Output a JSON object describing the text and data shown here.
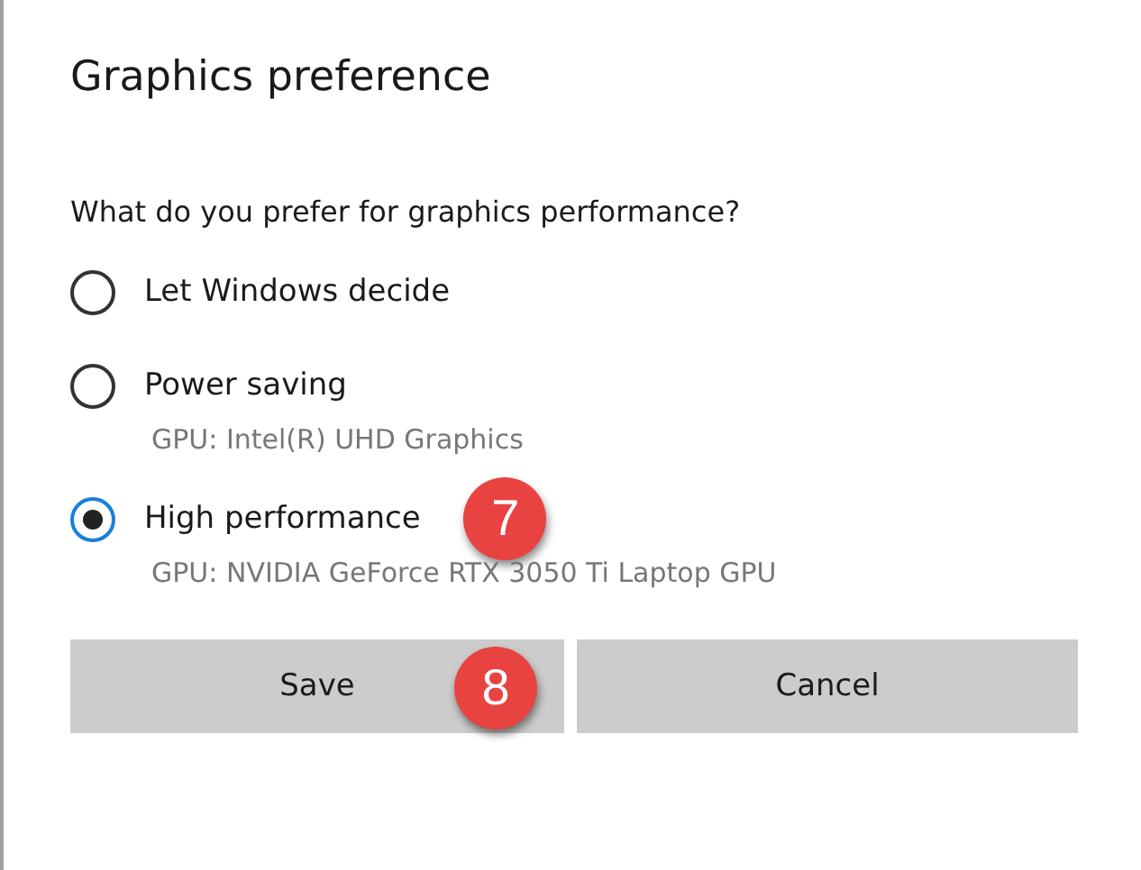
{
  "dialog": {
    "title": "Graphics preference",
    "question": "What do you prefer for graphics performance?",
    "options": [
      {
        "label": "Let Windows decide",
        "selected": false
      },
      {
        "label": "Power saving",
        "detail": "GPU: Intel(R) UHD Graphics",
        "selected": false
      },
      {
        "label": "High performance",
        "detail": "GPU: NVIDIA GeForce RTX 3050 Ti Laptop GPU",
        "selected": true,
        "callout": "7"
      }
    ],
    "buttons": [
      {
        "label": "Save",
        "callout": "8"
      },
      {
        "label": "Cancel"
      }
    ]
  }
}
